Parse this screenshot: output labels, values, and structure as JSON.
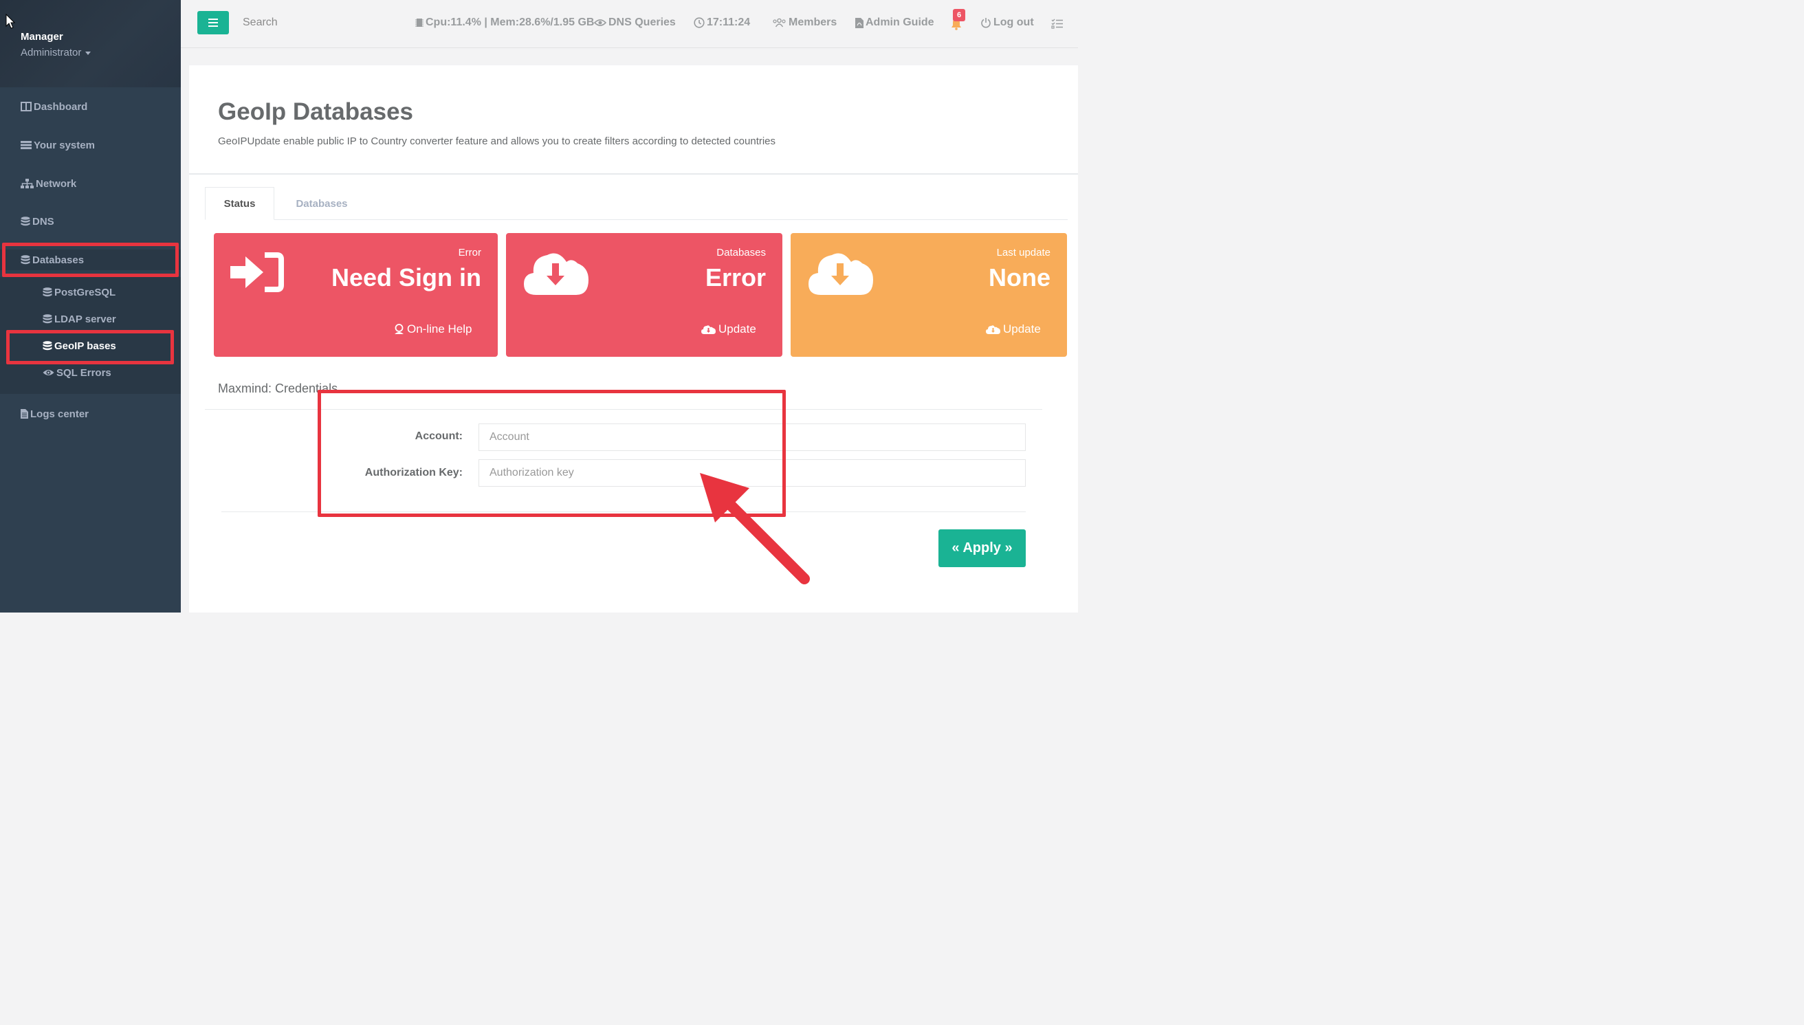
{
  "user": {
    "name": "Manager",
    "role": "Administrator"
  },
  "sidebar": {
    "items": [
      {
        "label": "Dashboard",
        "icon": "columns-icon"
      },
      {
        "label": "Your system",
        "icon": "server-icon"
      },
      {
        "label": "Network",
        "icon": "sitemap-icon"
      },
      {
        "label": "DNS",
        "icon": "database-icon"
      },
      {
        "label": "Databases",
        "icon": "database-icon"
      },
      {
        "label": "Logs center",
        "icon": "file-icon"
      }
    ],
    "sub_items": [
      {
        "label": "PostGreSQL",
        "icon": "database-icon"
      },
      {
        "label": "LDAP server",
        "icon": "database-icon"
      },
      {
        "label": "GeoIP bases",
        "icon": "database-icon"
      },
      {
        "label": "SQL Errors",
        "icon": "eye-icon"
      }
    ]
  },
  "topbar": {
    "search_label": "Search",
    "system_stats": "Cpu:11.4% | Mem:28.6%/1.95 GB",
    "dns_queries": "DNS Queries",
    "clock": "17:11:24",
    "members": "Members",
    "admin_guide": "Admin Guide",
    "notifications_count": "6",
    "logout": "Log out"
  },
  "page": {
    "title": "GeoIp Databases",
    "description": "GeoIPUpdate enable public IP to Country converter feature and allows you to create filters according to detected countries"
  },
  "tabs": [
    {
      "label": "Status",
      "active": true
    },
    {
      "label": "Databases",
      "active": false
    }
  ],
  "widgets": [
    {
      "label": "Error",
      "value": "Need Sign in",
      "link": "On-line Help",
      "color": "#ed5565"
    },
    {
      "label": "Databases",
      "value": "Error",
      "link": "Update",
      "color": "#ed5565"
    },
    {
      "label": "Last update",
      "value": "None",
      "link": "Update",
      "color": "#f8ac59"
    }
  ],
  "credentials": {
    "section_title": "Maxmind: Credentials",
    "account_label": "Account:",
    "account_placeholder": "Account",
    "key_label": "Authorization Key:",
    "key_placeholder": "Authorization key",
    "apply_label": "« Apply »"
  },
  "colors": {
    "sidebar": "#2f4050",
    "accent": "#1ab394",
    "danger": "#ed5565",
    "warning": "#f8ac59",
    "annotation": "#e8343f"
  }
}
